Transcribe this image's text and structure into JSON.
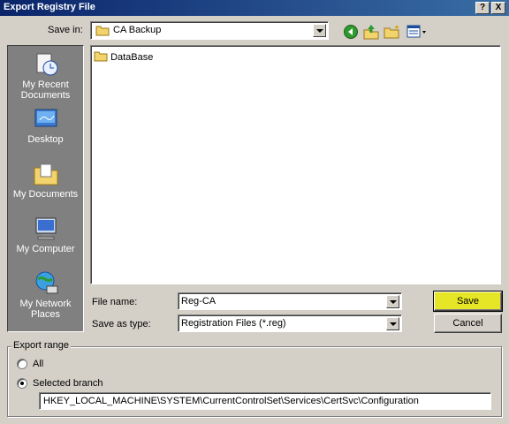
{
  "window": {
    "title": "Export Registry File",
    "help_label": "?",
    "close_label": "X"
  },
  "save_in": {
    "label": "Save in:",
    "value": "CA Backup"
  },
  "toolbar": {
    "icons": [
      "back-icon",
      "up-folder-icon",
      "new-folder-icon",
      "view-menu-icon"
    ]
  },
  "places": [
    {
      "label": "My Recent Documents",
      "icon": "recent-documents-icon"
    },
    {
      "label": "Desktop",
      "icon": "desktop-icon"
    },
    {
      "label": "My Documents",
      "icon": "my-documents-icon"
    },
    {
      "label": "My Computer",
      "icon": "my-computer-icon"
    },
    {
      "label": "My Network Places",
      "icon": "network-places-icon"
    }
  ],
  "files": [
    {
      "name": "DataBase",
      "icon": "folder-icon"
    }
  ],
  "file_name": {
    "label": "File name:",
    "value": "Reg-CA"
  },
  "save_as_type": {
    "label": "Save as type:",
    "value": "Registration Files (*.reg)"
  },
  "buttons": {
    "save": "Save",
    "cancel": "Cancel"
  },
  "export_range": {
    "legend": "Export range",
    "all_label": "All",
    "selected_label": "Selected branch",
    "selected": "selected_branch",
    "branch_value": "HKEY_LOCAL_MACHINE\\SYSTEM\\CurrentControlSet\\Services\\CertSvc\\Configuration"
  },
  "colors": {
    "title_bar": "#0a246a",
    "dialog_bg": "#d4d0c8",
    "places_bg": "#808080",
    "save_button_highlight": "#e6e626"
  }
}
